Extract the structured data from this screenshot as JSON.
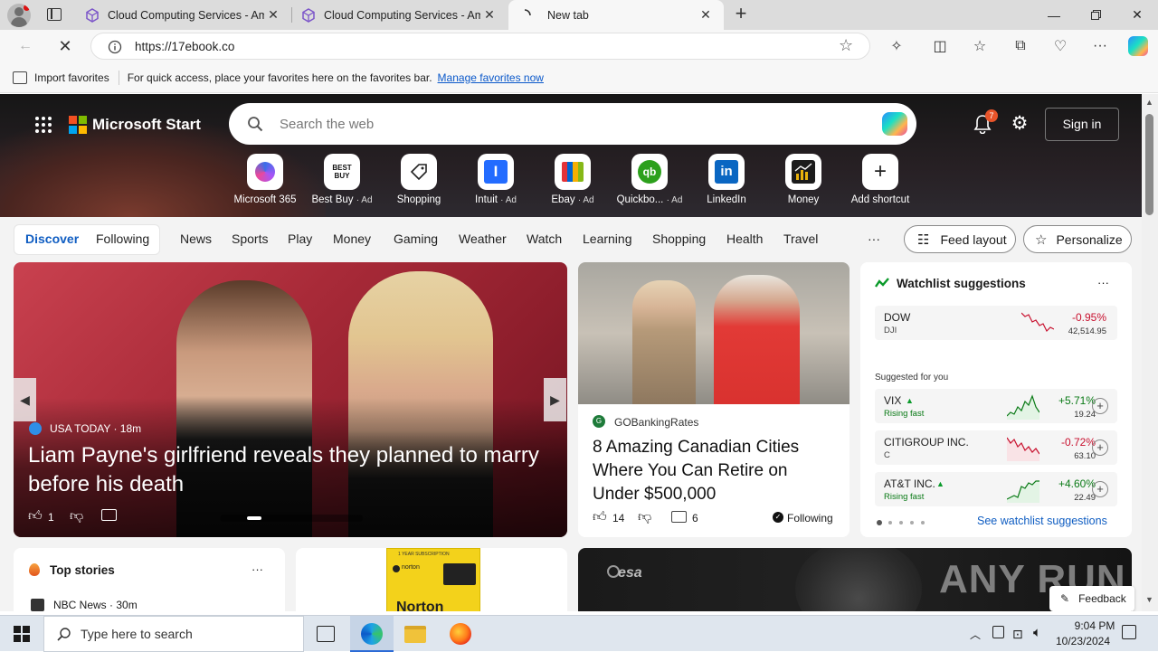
{
  "tabs": [
    {
      "title": "Cloud Computing Services - Am"
    },
    {
      "title": "Cloud Computing Services - Am"
    },
    {
      "title": "New tab"
    }
  ],
  "address": {
    "url": "https://17ebook.co"
  },
  "favbar": {
    "import": "Import favorites",
    "hint": "For quick access, place your favorites here on the favorites bar.",
    "manage": "Manage favorites now"
  },
  "brand": {
    "name": "Microsoft Start"
  },
  "search": {
    "placeholder": "Search the web"
  },
  "notif_count": "7",
  "signin": "Sign in",
  "shortcuts": [
    {
      "label": "Microsoft 365",
      "ad": ""
    },
    {
      "label": "Best Buy",
      "ad": "· Ad",
      "tile": "BEST BUY"
    },
    {
      "label": "Shopping",
      "ad": ""
    },
    {
      "label": "Intuit",
      "ad": "· Ad",
      "tile": "I"
    },
    {
      "label": "Ebay",
      "ad": "· Ad"
    },
    {
      "label": "Quickbo...",
      "ad": "· Ad",
      "tile": "qb"
    },
    {
      "label": "LinkedIn",
      "ad": "",
      "tile": "in"
    },
    {
      "label": "Money",
      "ad": ""
    },
    {
      "label": "Add shortcut",
      "ad": "",
      "tile": "+"
    }
  ],
  "nav": {
    "discover": "Discover",
    "following": "Following",
    "items": [
      "News",
      "Sports",
      "Play",
      "Money",
      "Gaming",
      "Weather",
      "Watch",
      "Learning",
      "Shopping",
      "Health",
      "Travel"
    ],
    "more": "···",
    "feed_layout": "Feed layout",
    "personalize": "Personalize"
  },
  "main_story": {
    "source": "USA TODAY · 18m",
    "headline": "Liam Payne's girlfriend reveals they planned to marry before his death",
    "likes": "1"
  },
  "side_story": {
    "source": "GOBankingRates",
    "headline": "8 Amazing Canadian Cities Where You Can Retire on Under $500,000",
    "likes": "14",
    "comments": "6",
    "following": "Following"
  },
  "watchlist": {
    "title": "Watchlist suggestions",
    "more": "···",
    "suggested": "Suggested for you",
    "see_all": "See watchlist suggestions",
    "dow": {
      "name": "DOW",
      "ticker": "DJI",
      "pct": "-0.95%",
      "value": "42,514.95"
    },
    "items": [
      {
        "name": "VIX",
        "sub": "Rising fast",
        "pct": "+5.71%",
        "value": "19.24",
        "color": "#0a7a16"
      },
      {
        "name": "CITIGROUP INC.",
        "sub": "C",
        "pct": "-0.72%",
        "value": "63.10",
        "color": "#c8102e"
      },
      {
        "name": "AT&T INC.",
        "sub": "Rising fast",
        "pct": "+4.60%",
        "value": "22.49",
        "color": "#0a7a16"
      }
    ]
  },
  "top_stories": {
    "title": "Top stories",
    "more": "···",
    "first_source": "NBC News · 30m"
  },
  "ad_card": {
    "label": "1 YEAR SUBSCRIPTION",
    "brand_small": "norton",
    "brand": "Norton"
  },
  "esa_card": {
    "brand": "esa"
  },
  "feedback": "Feedback",
  "watermark": "ANY RUN",
  "taskbar": {
    "search_placeholder": "Type here to search",
    "time": "9:04 PM",
    "date": "10/23/2024"
  }
}
